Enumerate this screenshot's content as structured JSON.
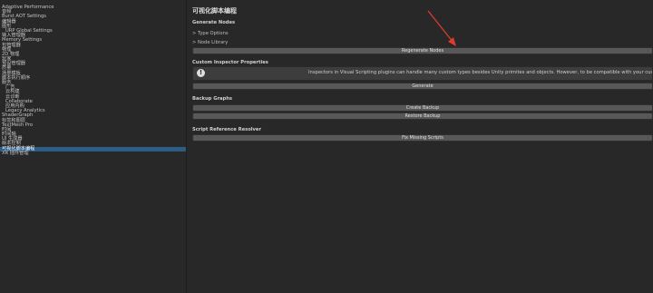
{
  "sidebar": {
    "items": [
      {
        "label": "Adaptive Performance"
      },
      {
        "label": "音频"
      },
      {
        "label": "Burst AOT Settings"
      },
      {
        "label": "编辑器"
      },
      {
        "label": "图形"
      },
      {
        "label": "URP Global Settings",
        "indent": true
      },
      {
        "label": "输入管理器"
      },
      {
        "label": "Memory Settings"
      },
      {
        "label": "包管理器"
      },
      {
        "label": "物理"
      },
      {
        "label": "2D 物理"
      },
      {
        "label": "玩家"
      },
      {
        "label": "预设管理器"
      },
      {
        "label": "质量"
      },
      {
        "label": "场景模板"
      },
      {
        "label": "脚本执行顺序"
      },
      {
        "label": "服务"
      },
      {
        "label": "广告",
        "indent": true
      },
      {
        "label": "云构建",
        "indent": true
      },
      {
        "label": "云诊断",
        "indent": true
      },
      {
        "label": "Collaborate",
        "indent": true
      },
      {
        "label": "应用内购",
        "indent": true
      },
      {
        "label": "Legacy Analytics",
        "indent": true
      },
      {
        "label": "ShaderGraph"
      },
      {
        "label": "标签和图层"
      },
      {
        "label": "TextMesh Pro"
      },
      {
        "label": "时间"
      },
      {
        "label": "时间轴"
      },
      {
        "label": "UI 生成器"
      },
      {
        "label": "版本控制"
      },
      {
        "label": "可视化脚本编程",
        "selected": true
      },
      {
        "label": "XR 插件管理"
      }
    ]
  },
  "main": {
    "title": "可视化脚本编程",
    "generate_nodes": {
      "header": "Generate Nodes",
      "type_options": "> Type Options",
      "node_library": "> Node Library",
      "regenerate_button": "Regenerate Nodes"
    },
    "custom_inspector": {
      "header": "Custom Inspector Properties",
      "info_text": "Inspectors in Visual Scripting plugins can handle many custom types besides Unity primites and objects. However, to be compatible with your custom editor drawers, some additional property provider scripts must be generated.",
      "generate_button": "Generate"
    },
    "backup": {
      "header": "Backup Graphs",
      "create_button": "Create Backup",
      "restore_button": "Restore Backup"
    },
    "resolver": {
      "header": "Script Reference Resolver",
      "fix_button": "Fix Missing Scripts"
    }
  },
  "colors": {
    "background": "#282828",
    "selection": "#2c5d87",
    "button": "#585858",
    "annotation_arrow": "#e03a2f"
  },
  "icons": {
    "info": "info-icon",
    "annotation": "red-arrow-annotation"
  }
}
